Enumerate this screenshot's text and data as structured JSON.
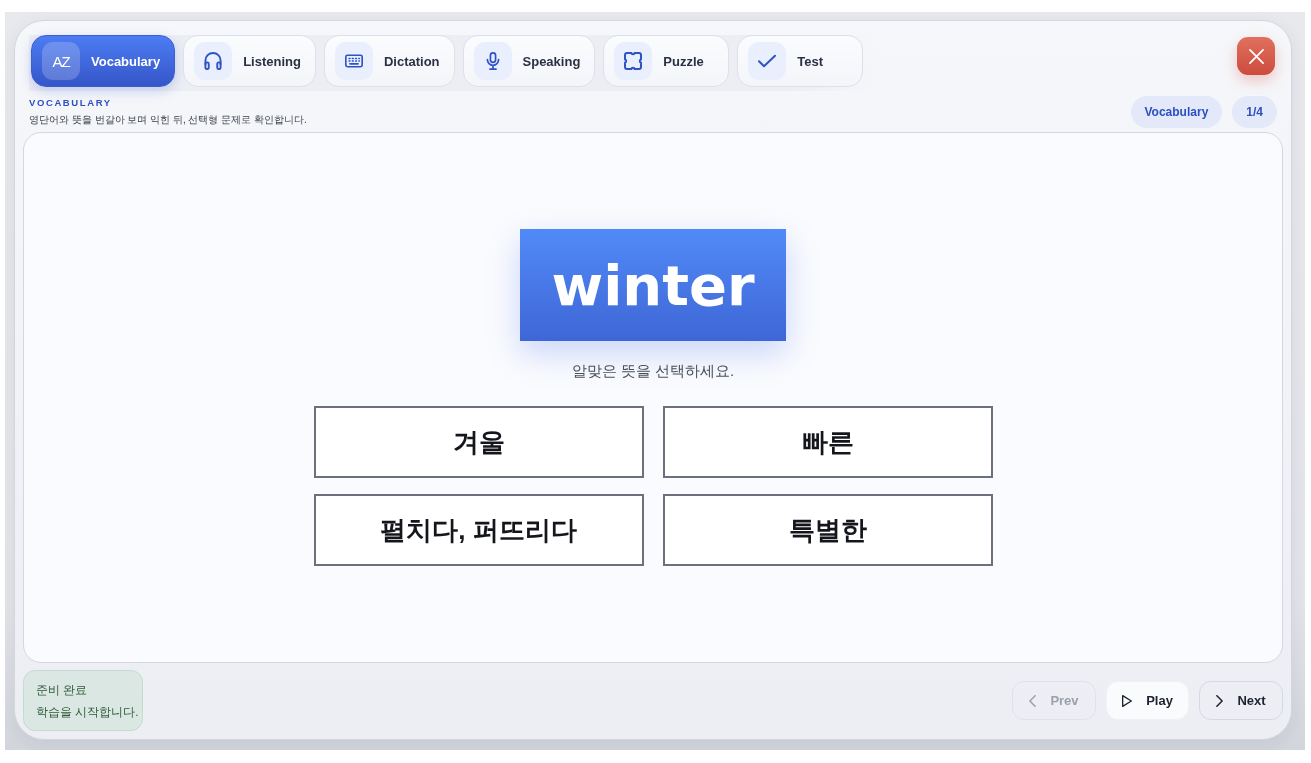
{
  "tabs": [
    {
      "label": "Vocabulary",
      "icon_text": "AZ",
      "selected": true
    },
    {
      "label": "Listening",
      "selected": false
    },
    {
      "label": "Dictation",
      "selected": false
    },
    {
      "label": "Speaking",
      "selected": false
    },
    {
      "label": "Puzzle",
      "selected": false
    },
    {
      "label": "Test",
      "selected": false
    }
  ],
  "header": {
    "eyebrow": "VOCABULARY",
    "description": "영단어와 뜻을 번갈아 보며 익힌 뒤, 선택형 문제로 확인합니다.",
    "badges": [
      "Vocabulary",
      "1/4"
    ]
  },
  "quiz": {
    "word": "winter",
    "prompt": "알맞은 뜻을 선택하세요.",
    "options": [
      {
        "label": "겨울",
        "selected": false
      },
      {
        "label": "빠른",
        "selected": false
      },
      {
        "label": "펼치다, 퍼뜨리다",
        "selected": false
      },
      {
        "label": "특별한",
        "selected": false
      }
    ]
  },
  "status": {
    "title": "준비 완료",
    "message": "학습을 시작합니다."
  },
  "nav_buttons": [
    {
      "kind": "prev",
      "label": "Prev",
      "disabled": true
    },
    {
      "kind": "play",
      "label": "Play",
      "disabled": false
    },
    {
      "kind": "next",
      "label": "Next",
      "disabled": false
    }
  ]
}
